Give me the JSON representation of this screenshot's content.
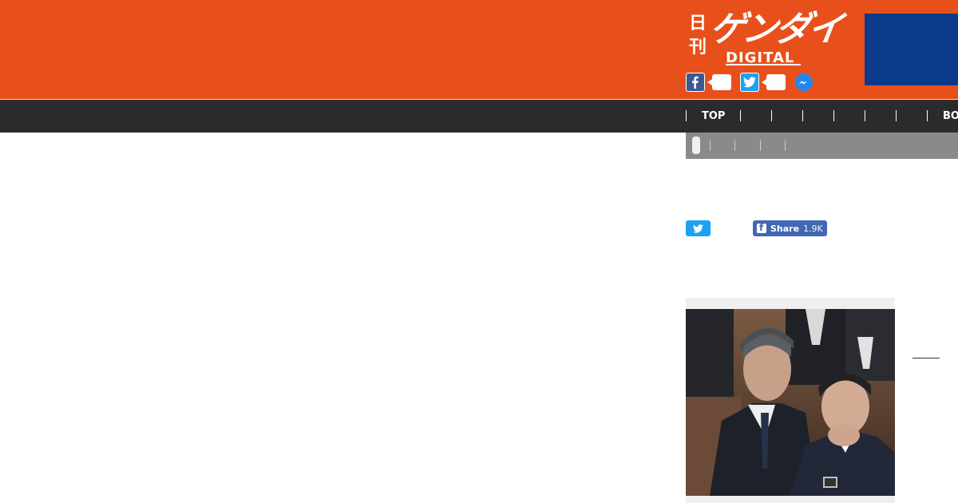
{
  "header": {
    "logo": {
      "nikkan": "日刊",
      "gendai": "ゲンダイ",
      "digital": "DIGITAL"
    },
    "social": {
      "facebook_icon": "facebook-icon",
      "twitter_icon": "twitter-icon",
      "messenger_icon": "messenger-icon"
    },
    "colors": {
      "brand_orange": "#e8501b",
      "ad_blue": "#0b3a8a",
      "nav_dark": "#2b2b2b"
    }
  },
  "nav": {
    "items": [
      "TOP",
      "",
      "",
      "",
      "",
      "",
      "",
      "BO"
    ]
  },
  "share": {
    "facebook_label": "Share",
    "facebook_count": "1.9K"
  }
}
